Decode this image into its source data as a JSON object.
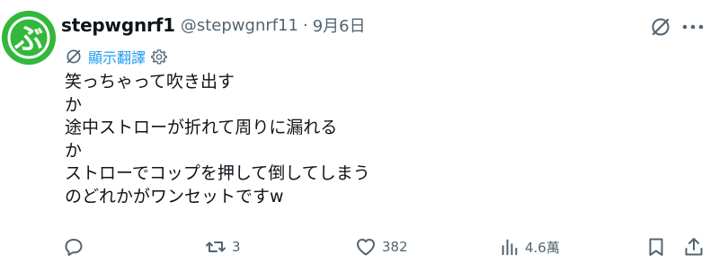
{
  "tweet": {
    "display_name": "stepwgnrf1",
    "handle": "@stepwgnrf11",
    "separator": "·",
    "date": "9月6日",
    "avatar_initial": "ぶ",
    "translate_label": "顯示翻譯",
    "lines": [
      "笑っちゃって吹き出す",
      "か",
      "途中ストローが折れて周りに漏れる",
      "か",
      "ストローでコップを押して倒してしまう",
      "のどれかがワンセットですw"
    ],
    "actions": {
      "reply_count": "",
      "retweet_count": "3",
      "like_count": "382",
      "views_count": "4.6萬"
    }
  },
  "icons": {
    "avatar": "avatar-image",
    "grok": "grok-icon",
    "more": "more-icon",
    "translate": "translate-icon",
    "settings": "gear-icon",
    "reply": "reply-icon",
    "retweet": "retweet-icon",
    "like": "heart-icon",
    "views": "views-icon",
    "bookmark": "bookmark-icon",
    "share": "share-icon"
  },
  "colors": {
    "text": "#0f1419",
    "muted": "#536471",
    "link": "#1d9bf0",
    "avatar_bg": "#32b83a"
  }
}
